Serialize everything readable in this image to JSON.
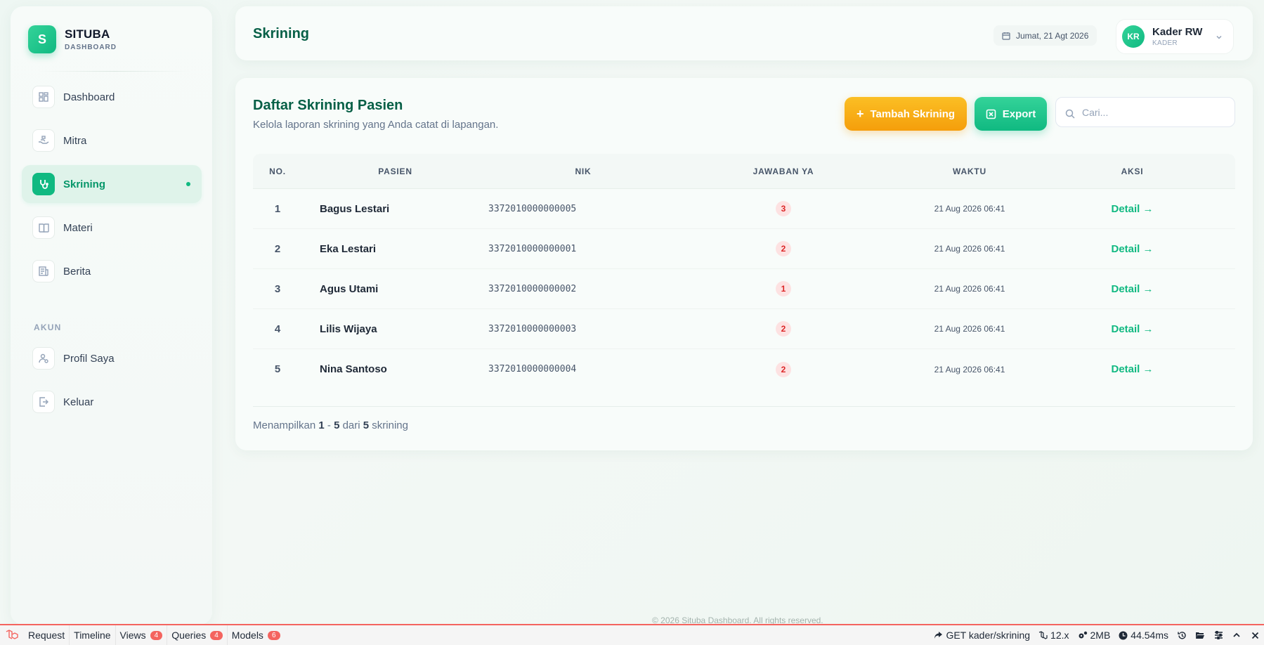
{
  "brand": {
    "logo_letter": "S",
    "title": "SITUBA",
    "subtitle": "DASHBOARD"
  },
  "sidebar": {
    "items": [
      {
        "label": "Dashboard",
        "icon": "grid-icon",
        "active": false
      },
      {
        "label": "Mitra",
        "icon": "handshake-icon",
        "active": false
      },
      {
        "label": "Skrining",
        "icon": "stethoscope-icon",
        "active": true
      },
      {
        "label": "Materi",
        "icon": "book-icon",
        "active": false
      },
      {
        "label": "Berita",
        "icon": "news-icon",
        "active": false
      }
    ],
    "section_label": "AKUN",
    "account_items": [
      {
        "label": "Profil Saya",
        "icon": "user-icon"
      },
      {
        "label": "Keluar",
        "icon": "logout-icon"
      }
    ]
  },
  "header": {
    "title": "Skrining",
    "date": "Jumat, 21 Agt 2026",
    "user": {
      "initials": "KR",
      "name": "Kader RW",
      "role": "KADER"
    }
  },
  "card": {
    "title": "Daftar Skrining Pasien",
    "subtitle": "Kelola laporan skrining yang Anda catat di lapangan.",
    "add_button": "Tambah Skrining",
    "export_button": "Export",
    "search_placeholder": "Cari..."
  },
  "table": {
    "columns": [
      "NO.",
      "PASIEN",
      "NIK",
      "JAWABAN YA",
      "WAKTU",
      "AKSI"
    ],
    "rows": [
      {
        "no": "1",
        "pasien": "Bagus Lestari",
        "nik": "3372010000000005",
        "jawaban": "3",
        "waktu": "21 Aug 2026 06:41",
        "aksi": "Detail →"
      },
      {
        "no": "2",
        "pasien": "Eka Lestari",
        "nik": "3372010000000001",
        "jawaban": "2",
        "waktu": "21 Aug 2026 06:41",
        "aksi": "Detail →"
      },
      {
        "no": "3",
        "pasien": "Agus Utami",
        "nik": "3372010000000002",
        "jawaban": "1",
        "waktu": "21 Aug 2026 06:41",
        "aksi": "Detail →"
      },
      {
        "no": "4",
        "pasien": "Lilis Wijaya",
        "nik": "3372010000000003",
        "jawaban": "2",
        "waktu": "21 Aug 2026 06:41",
        "aksi": "Detail →"
      },
      {
        "no": "5",
        "pasien": "Nina Santoso",
        "nik": "3372010000000004",
        "jawaban": "2",
        "waktu": "21 Aug 2026 06:41",
        "aksi": "Detail →"
      }
    ]
  },
  "summary": {
    "prefix": "Menampilkan",
    "from": "1",
    "sep": "-",
    "to": "5",
    "mid": "dari",
    "total": "5",
    "suffix": "skrining"
  },
  "footer": {
    "copyright": "© 2026 Situba Dashboard. All rights reserved."
  },
  "debugbar": {
    "tabs": [
      {
        "label": "Request",
        "badge": ""
      },
      {
        "label": "Timeline",
        "badge": ""
      },
      {
        "label": "Views",
        "badge": "4"
      },
      {
        "label": "Queries",
        "badge": "4"
      },
      {
        "label": "Models",
        "badge": "6"
      }
    ],
    "route": "GET kader/skrining",
    "version": "12.x",
    "memory": "2MB",
    "time": "44.54ms"
  },
  "colors": {
    "primary": "#10b981",
    "primary_dark": "#065f46",
    "accent": "#f59e0b",
    "danger": "#dc2626"
  }
}
